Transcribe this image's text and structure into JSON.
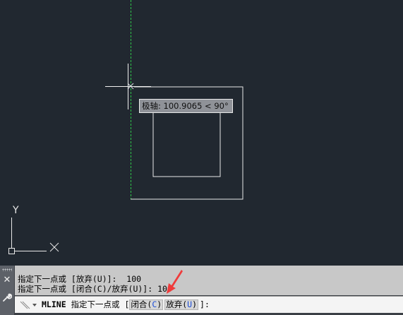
{
  "tooltip": {
    "text": "极轴: 100.9065 < 90°"
  },
  "ucs": {
    "y_label": "Y",
    "x_label": "✕"
  },
  "history": {
    "line1": "指定下一点或 [放弃(U)]:  100",
    "line2": "指定下一点或 [闭合(C)/放弃(U)]: 100"
  },
  "command": {
    "name": "MLINE",
    "prompt": "指定下一点或 [",
    "options": [
      {
        "label": "闭合(",
        "key": "C",
        "close": ")"
      },
      {
        "label": "放弃(",
        "key": "U",
        "close": ")"
      }
    ],
    "suffix": "]:"
  },
  "side": {
    "close_icon": "close-icon",
    "wrench_icon": "wrench-icon"
  },
  "colors": {
    "canvas": "#212830",
    "tracking_line": "#22c55e",
    "annotation_arrow": "#ef3b3b"
  }
}
